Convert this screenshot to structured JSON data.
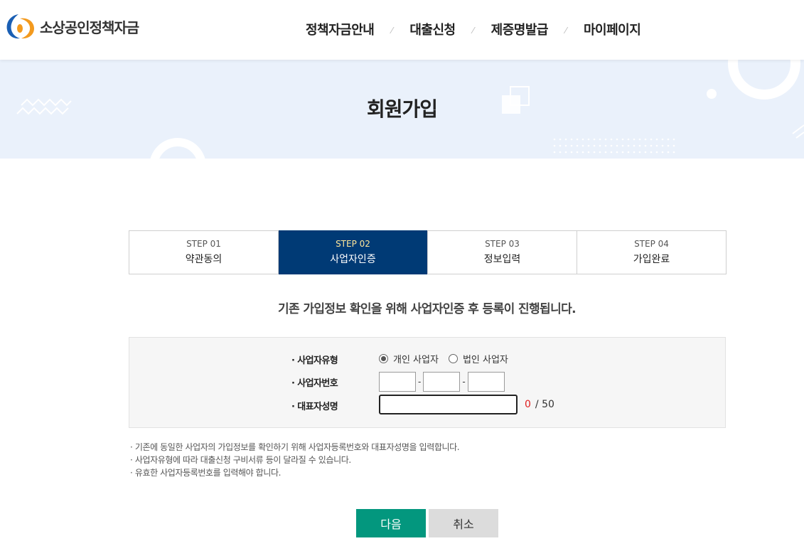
{
  "header": {
    "logo_text": "소상공인정책자금",
    "nav": [
      "정책자금안내",
      "대출신청",
      "제증명발급",
      "마이페이지"
    ]
  },
  "banner": {
    "title": "회원가입"
  },
  "steps": [
    {
      "no": "STEP 01",
      "label": "약관동의"
    },
    {
      "no": "STEP 02",
      "label": "사업자인증"
    },
    {
      "no": "STEP 03",
      "label": "정보입력"
    },
    {
      "no": "STEP 04",
      "label": "가입완료"
    }
  ],
  "guide_text": "기존 가입정보 확인을 위해 사업자인증 후 등록이 진행됩니다.",
  "form": {
    "type_label": "· 사업자유형",
    "type_options": [
      "개인 사업자",
      "법인 사업자"
    ],
    "selected_option": "개인 사업자",
    "biz_no_label": "· 사업자번호",
    "biz_no_values": [
      "",
      "",
      ""
    ],
    "name_label": "· 대표자성명",
    "name_value": "",
    "name_count": "0",
    "name_max": "/ 50",
    "dash": "-"
  },
  "notes": [
    "· 기존에 동일한 사업자의 가입정보를 확인하기 위해 사업자등록번호와 대표자성명을 입력합니다.",
    "· 사업자유형에 따라 대출신청 구비서류 등이 달라질 수 있습니다.",
    "· 유효한 사업자등록번호를 입력해야 합니다."
  ],
  "buttons": {
    "next": "다음",
    "cancel": "취소"
  },
  "colors": {
    "active_step": "#003a75",
    "next_button": "#03977e",
    "banner_bg": "#eaf1fb"
  }
}
